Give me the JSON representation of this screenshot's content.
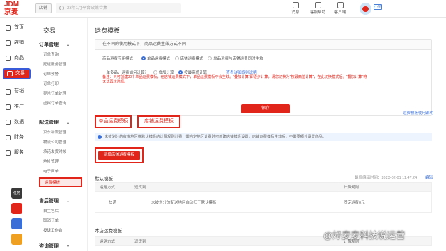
{
  "brand": {
    "line1": "JDM",
    "line2": "京麦",
    "color": "#e1251b"
  },
  "header": {
    "workspace_button": "店铺",
    "search_placeholder": "23年1月平台政策合集",
    "tools": [
      {
        "label": "消息"
      },
      {
        "label": "客服帮助"
      },
      {
        "label": "客户端"
      }
    ],
    "shop_tag": "小浣"
  },
  "nav": {
    "items": [
      {
        "label": "首页",
        "icon": "home-icon"
      },
      {
        "label": "店铺",
        "icon": "store-icon"
      },
      {
        "label": "商品",
        "icon": "box-icon"
      },
      {
        "label": "交易",
        "icon": "transaction-icon",
        "active": true
      },
      {
        "label": "营销",
        "icon": "megaphone-icon"
      },
      {
        "label": "推广",
        "icon": "promote-icon"
      },
      {
        "label": "数据",
        "icon": "chart-icon"
      },
      {
        "label": "财务",
        "icon": "finance-icon"
      },
      {
        "label": "服务",
        "icon": "service-icon"
      }
    ],
    "apps": [
      {
        "label": "任务",
        "color": "#3a3a3a"
      },
      {
        "label": "",
        "color": "#e1251b"
      },
      {
        "label": "",
        "color": "#3a6fd8"
      },
      {
        "label": "",
        "color": "#f0a020"
      }
    ]
  },
  "subnav": {
    "title": "交易",
    "groups": [
      {
        "label": "订单管理",
        "items": [
          "订单查询",
          "延迟服务管理",
          "订单预警",
          "订单打印",
          "异常订单处理",
          "虚拟订单查询"
        ]
      },
      {
        "label": "配送管理",
        "items": [
          "京东物流管理",
          "物流公司管理",
          "承诺发货时效",
          "地址管理",
          "电子面单",
          "运费模板"
        ]
      },
      {
        "label": "售后管理",
        "items": [
          "自主售后",
          "取消订单",
          "投诉工作台"
        ]
      },
      {
        "label": "咨询管理",
        "items": []
      }
    ],
    "active_item": "运费模板"
  },
  "main": {
    "title": "运费模板",
    "settings": {
      "header": "在不同的使用模式下，商品运费生效方式不同：",
      "radio_label": "商品运费应用模式：",
      "options": [
        "单品运费模式",
        "店铺运费模式",
        "单品运费与店铺运费同时生效"
      ],
      "selected": 0,
      "mode_label": "一单多品，运费如何计算？",
      "mode_options": [
        "叠加计算",
        "按最高值计算"
      ],
      "mode_selected": 1,
      "view_link": "查看详细规则说明",
      "warning": "备注：只可创建30个单品运费模板，在店铺运费模式下，单品运费模板不会生效。“叠加计算”即逐步计算，请您切换为“按最高值计算”，在此切换模式后，“叠加计算”将无法再次选择。",
      "save_label": "保存"
    },
    "help_link": "运费模板使用说明",
    "tabs": [
      "单品运费模板",
      "店铺运费模板"
    ],
    "info": "未被划分的收货地区将默认模板的计费规则计费，需自定地区计费时可新建店铺模板设置，店铺运费模板生效后，不需要额外设置商品。",
    "new_button": "新增店铺运费模板",
    "default_section": {
      "title": "默认模板",
      "updated": "最后编辑时间：2023-02-01 11:47:24",
      "edit_link": "编辑",
      "columns": [
        "运送方式",
        "送货到",
        "计费规则"
      ],
      "rows": [
        [
          "快递",
          "未被划分的配送地区自动归于默认模板",
          "固定运费0元"
        ]
      ]
    },
    "shop_section": {
      "title": "本店运费模板",
      "columns": [
        "运送方式",
        "送货到",
        "计费规则"
      ]
    }
  },
  "watermark": "@好麦麦科技说运营"
}
